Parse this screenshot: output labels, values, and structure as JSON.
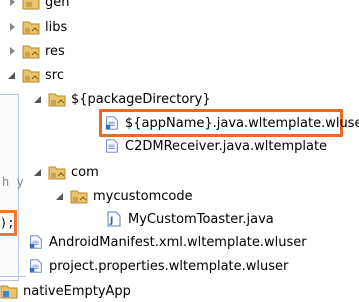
{
  "tree": {
    "items": [
      {
        "label": "gen",
        "icon": "package-folder-icon",
        "state": "collapsed"
      },
      {
        "label": "libs",
        "icon": "package-folder-icon",
        "state": "collapsed"
      },
      {
        "label": "res",
        "icon": "package-folder-icon",
        "state": "collapsed"
      },
      {
        "label": "src",
        "icon": "package-folder-icon",
        "state": "expanded"
      },
      {
        "label": "${packageDirectory}",
        "icon": "package-folder-icon",
        "state": "expanded"
      },
      {
        "label": "${appName}.java.wltemplate.wluser",
        "icon": "file-icon",
        "state": "none"
      },
      {
        "label": "C2DMReceiver.java.wltemplate",
        "icon": "file-icon",
        "state": "none"
      },
      {
        "label": "com",
        "icon": "package-folder-icon",
        "state": "expanded"
      },
      {
        "label": "mycustomcode",
        "icon": "package-folder-icon",
        "state": "expanded"
      },
      {
        "label": "MyCustomToaster.java",
        "icon": "java-file-icon",
        "state": "none"
      },
      {
        "label": "AndroidManifest.xml.wltemplate.wluser",
        "icon": "file-icon",
        "state": "none"
      },
      {
        "label": "project.properties.wltemplate.wluser",
        "icon": "file-icon",
        "state": "none"
      },
      {
        "label": "nativeEmptyApp",
        "icon": "project-folder-icon",
        "state": "none"
      }
    ]
  },
  "editor": {
    "code_fragment": "h y",
    "code_line_end": ");"
  },
  "colors": {
    "highlight": "#ea6a23",
    "editor_border": "#b8c6e0"
  }
}
